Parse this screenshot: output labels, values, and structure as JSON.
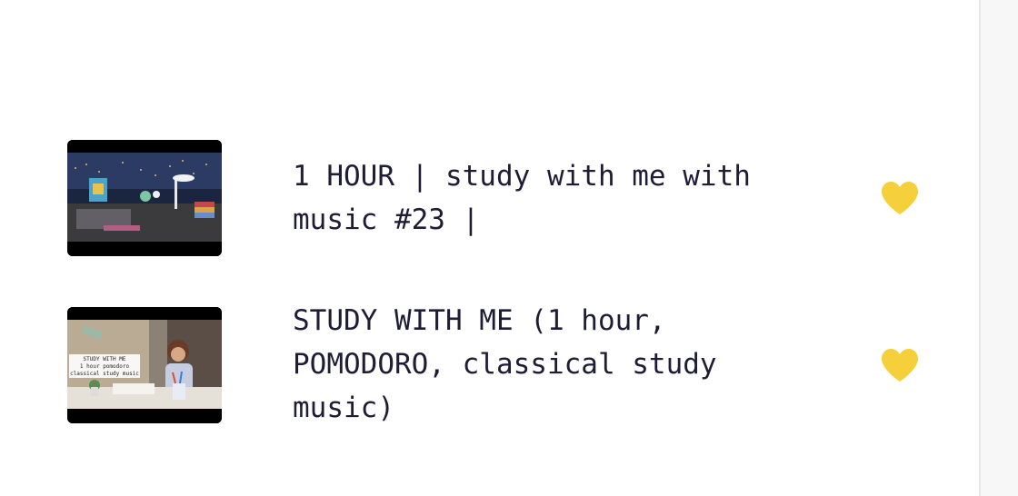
{
  "videos": [
    {
      "title": "1 HOUR | study with me with music #23 |",
      "favorite": true,
      "thumbnail_icon": "thumbnail-image"
    },
    {
      "title": "STUDY WITH ME (1 hour, POMODORO, classical study music)",
      "favorite": true,
      "thumbnail_icon": "thumbnail-image",
      "thumbnail_text": [
        "STUDY WITH ME",
        "1 hour pomodoro",
        "classical study music"
      ]
    }
  ],
  "colors": {
    "heart": "#f5d03b",
    "title": "#1f1d36"
  },
  "icons": {
    "favorite": "heart-icon"
  }
}
